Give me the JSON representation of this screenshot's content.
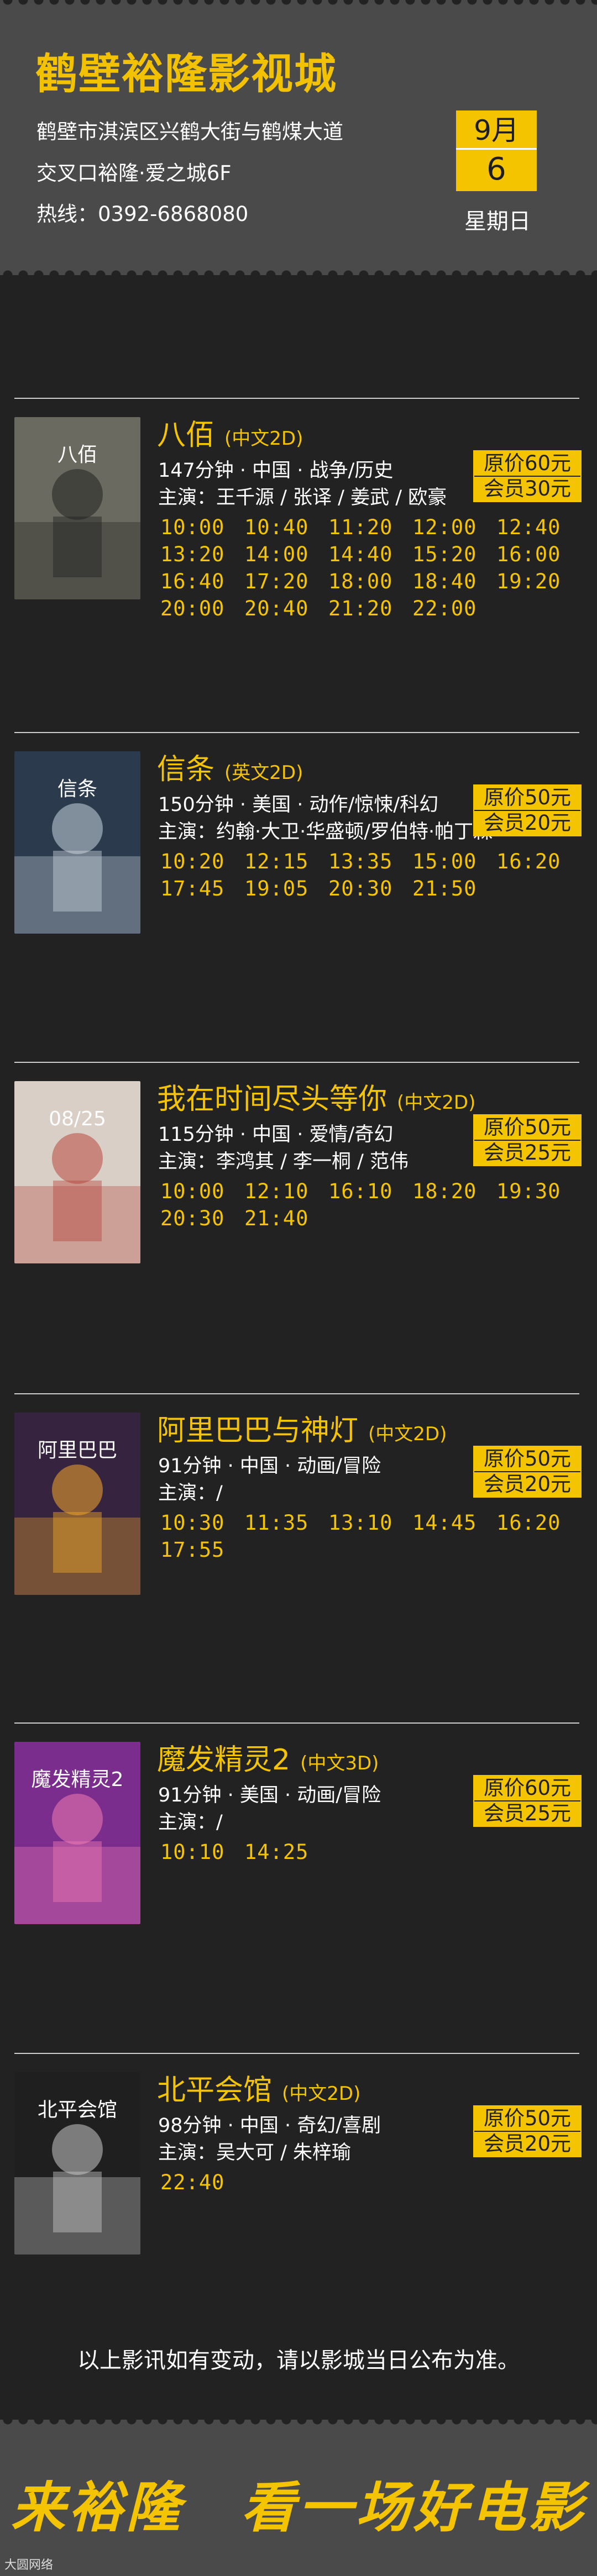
{
  "header": {
    "cinema_name": "鹤壁裕隆影视城",
    "address_line1": "鹤壁市淇滨区兴鹤大街与鹤煤大道",
    "address_line2": "交叉口裕隆·爱之城6F",
    "hotline": "热线：0392-6868080",
    "month": "9月",
    "day": "6",
    "weekday": "星期日"
  },
  "movies": [
    {
      "title": "八佰",
      "lang": "(中文2D)",
      "info": "147分钟 · 中国 · 战争/历史",
      "cast": "主演：王千源 / 张译 / 姜武 / 欧豪",
      "price_original": "原价60元",
      "price_member": "会员30元",
      "times": [
        "10:00",
        "10:40",
        "11:20",
        "12:00",
        "12:40",
        "13:20",
        "14:00",
        "14:40",
        "15:20",
        "16:00",
        "16:40",
        "17:20",
        "18:00",
        "18:40",
        "19:20",
        "20:00",
        "20:40",
        "21:20",
        "22:00"
      ]
    },
    {
      "title": "信条",
      "lang": "(英文2D)",
      "info": "150分钟 · 美国 · 动作/惊悚/科幻",
      "cast": "主演：约翰·大卫·华盛顿/罗伯特·帕丁森",
      "price_original": "原价50元",
      "price_member": "会员20元",
      "times": [
        "10:20",
        "12:15",
        "13:35",
        "15:00",
        "16:20",
        "17:45",
        "19:05",
        "20:30",
        "21:50"
      ]
    },
    {
      "title": "我在时间尽头等你",
      "lang": "(中文2D)",
      "info": "115分钟 · 中国 · 爱情/奇幻",
      "cast": "主演：李鸿其 / 李一桐 / 范伟",
      "price_original": "原价50元",
      "price_member": "会员25元",
      "times": [
        "10:00",
        "12:10",
        "16:10",
        "18:20",
        "19:30",
        "20:30",
        "21:40"
      ]
    },
    {
      "title": "阿里巴巴与神灯",
      "lang": "(中文2D)",
      "info": "91分钟 · 中国 · 动画/冒险",
      "cast": "主演：/",
      "price_original": "原价50元",
      "price_member": "会员20元",
      "times": [
        "10:30",
        "11:35",
        "13:10",
        "14:45",
        "16:20",
        "17:55"
      ]
    },
    {
      "title": "魔发精灵2",
      "lang": "(中文3D)",
      "info": "91分钟 · 美国 · 动画/冒险",
      "cast": "主演：/",
      "price_original": "原价60元",
      "price_member": "会员25元",
      "times": [
        "10:10",
        "14:25"
      ]
    },
    {
      "title": "北平会馆",
      "lang": "(中文2D)",
      "info": "98分钟 · 中国 · 奇幻/喜剧",
      "cast": "主演：吴大可 / 朱梓瑜",
      "price_original": "原价50元",
      "price_member": "会员20元",
      "times": [
        "22:40"
      ]
    }
  ],
  "posters": [
    {
      "label": "八佰",
      "bg": "#6b6a60",
      "accent": "#222222"
    },
    {
      "label": "信条",
      "bg": "#2b3a4c",
      "accent": "#c9d3dc"
    },
    {
      "label": "08/25",
      "bg": "#d9cfc6",
      "accent": "#b8483e"
    },
    {
      "label": "阿里巴巴",
      "bg": "#35233f",
      "accent": "#f2a829"
    },
    {
      "label": "魔发精灵2",
      "bg": "#7a2d8c",
      "accent": "#f27bb4"
    },
    {
      "label": "北平会馆",
      "bg": "#1f1f1f",
      "accent": "#c8c8c8"
    }
  ],
  "notice": "以上影讯如有变动，请以影城当日公布为准。",
  "slogan": "来裕隆　看一场好电影",
  "watermark": "大圆网络",
  "colors": {
    "accent": "#f5c400",
    "background": "#222222",
    "panel": "#4a4a4a"
  }
}
